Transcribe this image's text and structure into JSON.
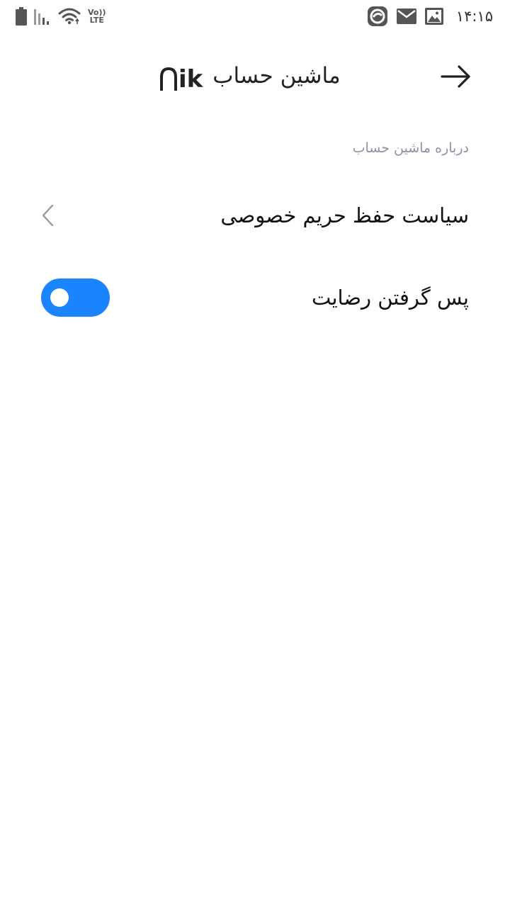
{
  "status_bar": {
    "time": "۱۴:۱۵",
    "volte_top": "Vo))",
    "volte_bottom": "LTE",
    "icons_left": [
      "battery-icon",
      "signal-icon",
      "wifi-icon",
      "volte-icon"
    ],
    "icons_right": [
      "app-notification-icon",
      "mail-icon",
      "image-icon"
    ]
  },
  "header": {
    "logo_text": "ik",
    "title": "ماشین حساب",
    "back_icon": "arrow-right-icon"
  },
  "section": {
    "label": "درباره ماشین حساب"
  },
  "rows": {
    "privacy": {
      "label": "سیاست حفظ حریم خصوصی",
      "icon": "chevron-left-icon"
    },
    "consent": {
      "label": "پس گرفتن رضایت",
      "toggle_on": true,
      "accent": "#1a84ff"
    }
  },
  "colors": {
    "background": "#ffffff",
    "text_primary": "#111111",
    "text_secondary": "#8c93a3",
    "accent": "#1a84ff"
  }
}
